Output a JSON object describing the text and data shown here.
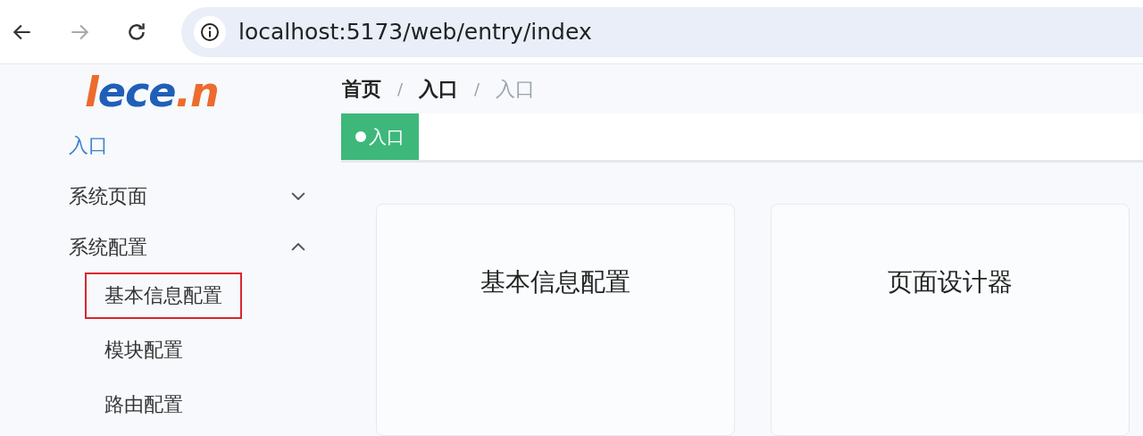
{
  "browser": {
    "url": "localhost:5173/web/entry/index",
    "back_enabled": true,
    "forward_enabled": false
  },
  "logo": {
    "text": "lece.n"
  },
  "breadcrumb_separator": "/",
  "breadcrumb": [
    {
      "label": "首页",
      "current": false
    },
    {
      "label": "入口",
      "current": false
    },
    {
      "label": "入口",
      "current": true
    }
  ],
  "tags": [
    {
      "label": "入口",
      "selected": true
    }
  ],
  "sidebar": {
    "items": [
      {
        "label": "入口",
        "selected": true
      },
      {
        "label": "系统页面",
        "selected": false,
        "expanded": false
      },
      {
        "label": "系统配置",
        "selected": false,
        "expanded": true,
        "children": [
          {
            "label": "基本信息配置",
            "highlighted": true
          },
          {
            "label": "模块配置",
            "highlighted": false
          },
          {
            "label": "路由配置",
            "highlighted": false
          }
        ]
      }
    ]
  },
  "cards": [
    {
      "title": "基本信息配置"
    },
    {
      "title": "页面设计器"
    }
  ]
}
